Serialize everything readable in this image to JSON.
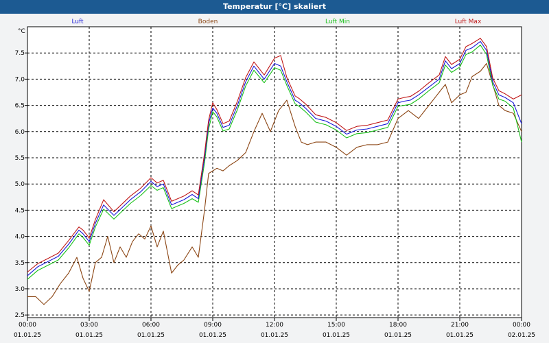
{
  "window": {
    "title": "Temperatur [°C] skaliert"
  },
  "chart_data": {
    "type": "line",
    "title": "Temperatur [°C] skaliert",
    "ylabel": "°C",
    "ylim": [
      2.45,
      8.0
    ],
    "xlim": [
      0,
      24
    ],
    "yticks": [
      "2.5",
      "3.0",
      "3.5",
      "4.0",
      "4.5",
      "5.0",
      "5.5",
      "6.0",
      "6.5",
      "7.0",
      "7.5"
    ],
    "xticks": [
      {
        "time": "00:00",
        "date": "01.01.25"
      },
      {
        "time": "03:00",
        "date": "01.01.25"
      },
      {
        "time": "06:00",
        "date": "01.01.25"
      },
      {
        "time": "09:00",
        "date": "01.01.25"
      },
      {
        "time": "12:00",
        "date": "01.01.25"
      },
      {
        "time": "15:00",
        "date": "01.01.25"
      },
      {
        "time": "18:00",
        "date": "01.01.25"
      },
      {
        "time": "21:00",
        "date": "01.01.25"
      },
      {
        "time": "00:00",
        "date": "02.01.25"
      }
    ],
    "grid": true,
    "legend_position": "top",
    "colors": {
      "Luft": "#1818d8",
      "Boden": "#8b4513",
      "Luft Min": "#18c018",
      "Luft Max": "#c01818"
    },
    "series": [
      {
        "name": "Luft",
        "x": [
          0,
          0.5,
          1,
          1.5,
          2,
          2.5,
          2.7,
          3.0,
          3.3,
          3.7,
          4.2,
          4.6,
          5,
          5.5,
          6,
          6.3,
          6.6,
          7,
          7.3,
          7.6,
          8,
          8.3,
          8.6,
          8.8,
          9.0,
          9.2,
          9.5,
          9.8,
          10.2,
          10.6,
          11,
          11.5,
          12,
          12.3,
          12.6,
          13,
          13.2,
          13.5,
          14,
          14.5,
          15,
          15.5,
          16,
          16.5,
          17,
          17.5,
          18,
          18.3,
          18.6,
          19,
          19.5,
          20,
          20.3,
          20.6,
          21,
          21.3,
          21.6,
          22,
          22.3,
          22.6,
          22.9,
          23.2,
          23.6,
          24
        ],
        "y": [
          3.25,
          3.42,
          3.52,
          3.62,
          3.85,
          4.12,
          4.05,
          3.9,
          4.25,
          4.6,
          4.4,
          4.55,
          4.7,
          4.85,
          5.05,
          4.95,
          5.0,
          4.6,
          4.65,
          4.7,
          4.8,
          4.72,
          5.5,
          6.15,
          6.45,
          6.35,
          6.08,
          6.12,
          6.5,
          6.95,
          7.25,
          7.0,
          7.3,
          7.25,
          6.95,
          6.6,
          6.55,
          6.45,
          6.25,
          6.2,
          6.1,
          5.95,
          6.03,
          6.05,
          6.1,
          6.15,
          6.55,
          6.58,
          6.6,
          6.7,
          6.85,
          7.0,
          7.35,
          7.2,
          7.3,
          7.55,
          7.6,
          7.72,
          7.55,
          6.95,
          6.7,
          6.65,
          6.55,
          6.15
        ]
      },
      {
        "name": "Boden",
        "x": [
          0,
          0.4,
          0.8,
          1.2,
          1.6,
          2,
          2.4,
          2.7,
          3.0,
          3.3,
          3.6,
          3.9,
          4.2,
          4.5,
          4.8,
          5.1,
          5.4,
          5.7,
          6.0,
          6.3,
          6.6,
          7.0,
          7.3,
          7.6,
          8.0,
          8.3,
          8.6,
          8.8,
          9.0,
          9.2,
          9.5,
          9.8,
          10.2,
          10.6,
          11,
          11.4,
          11.8,
          12.2,
          12.6,
          13.0,
          13.3,
          13.6,
          14,
          14.5,
          15,
          15.5,
          16,
          16.5,
          17,
          17.5,
          18,
          18.5,
          19,
          19.5,
          20,
          20.3,
          20.6,
          21,
          21.3,
          21.6,
          22,
          22.3,
          22.6,
          22.9,
          23.2,
          23.6,
          24
        ],
        "y": [
          2.85,
          2.85,
          2.7,
          2.85,
          3.1,
          3.3,
          3.6,
          3.2,
          2.95,
          3.5,
          3.6,
          4.0,
          3.5,
          3.8,
          3.6,
          3.9,
          4.05,
          3.95,
          4.2,
          3.8,
          4.1,
          3.3,
          3.45,
          3.55,
          3.8,
          3.6,
          4.5,
          5.2,
          5.25,
          5.3,
          5.25,
          5.35,
          5.45,
          5.6,
          6.0,
          6.35,
          6.0,
          6.4,
          6.6,
          6.1,
          5.8,
          5.75,
          5.8,
          5.8,
          5.7,
          5.55,
          5.7,
          5.75,
          5.75,
          5.8,
          6.25,
          6.4,
          6.25,
          6.5,
          6.75,
          6.9,
          6.55,
          6.7,
          6.75,
          7.05,
          7.15,
          7.3,
          6.9,
          6.5,
          6.4,
          6.35,
          6.0
        ]
      },
      {
        "name": "Luft Min",
        "x": [
          0,
          0.5,
          1,
          1.5,
          2,
          2.5,
          2.7,
          3.0,
          3.3,
          3.7,
          4.2,
          4.6,
          5,
          5.5,
          6,
          6.3,
          6.6,
          7,
          7.3,
          7.6,
          8,
          8.3,
          8.6,
          8.8,
          9.0,
          9.2,
          9.5,
          9.8,
          10.2,
          10.6,
          11,
          11.5,
          12,
          12.3,
          12.6,
          13,
          13.2,
          13.5,
          14,
          14.5,
          15,
          15.5,
          16,
          16.5,
          17,
          17.5,
          18,
          18.3,
          18.6,
          19,
          19.5,
          20,
          20.3,
          20.6,
          21,
          21.3,
          21.6,
          22,
          22.3,
          22.6,
          22.9,
          23.2,
          23.6,
          24
        ],
        "y": [
          3.18,
          3.35,
          3.45,
          3.55,
          3.78,
          4.05,
          3.98,
          3.83,
          4.18,
          4.52,
          4.33,
          4.48,
          4.63,
          4.78,
          4.97,
          4.88,
          4.93,
          4.53,
          4.58,
          4.63,
          4.72,
          4.65,
          5.4,
          6.05,
          6.38,
          6.28,
          6.01,
          6.05,
          6.42,
          6.87,
          7.17,
          6.93,
          7.22,
          7.17,
          6.88,
          6.53,
          6.48,
          6.38,
          6.18,
          6.13,
          6.03,
          5.88,
          5.96,
          5.98,
          6.03,
          6.08,
          6.48,
          6.5,
          6.52,
          6.62,
          6.78,
          6.93,
          7.27,
          7.13,
          7.23,
          7.47,
          7.52,
          7.65,
          7.47,
          6.88,
          6.62,
          6.58,
          6.45,
          5.8
        ]
      },
      {
        "name": "Luft Max",
        "x": [
          0,
          0.5,
          1,
          1.5,
          2,
          2.5,
          2.7,
          3.0,
          3.3,
          3.7,
          4.2,
          4.6,
          5,
          5.5,
          6,
          6.3,
          6.6,
          7,
          7.3,
          7.6,
          8,
          8.3,
          8.6,
          8.8,
          9.0,
          9.2,
          9.5,
          9.8,
          10.2,
          10.6,
          11,
          11.5,
          12,
          12.3,
          12.6,
          13,
          13.2,
          13.5,
          14,
          14.5,
          15,
          15.5,
          16,
          16.5,
          17,
          17.5,
          18,
          18.3,
          18.6,
          19,
          19.5,
          20,
          20.3,
          20.6,
          21,
          21.3,
          21.6,
          22,
          22.3,
          22.6,
          22.9,
          23.2,
          23.6,
          24
        ],
        "y": [
          3.32,
          3.48,
          3.58,
          3.68,
          3.92,
          4.18,
          4.12,
          3.97,
          4.32,
          4.7,
          4.47,
          4.62,
          4.77,
          4.92,
          5.12,
          5.02,
          5.07,
          4.67,
          4.72,
          4.77,
          4.87,
          4.79,
          5.58,
          6.22,
          6.55,
          6.42,
          6.15,
          6.2,
          6.58,
          7.03,
          7.33,
          7.08,
          7.4,
          7.45,
          7.03,
          6.68,
          6.63,
          6.53,
          6.32,
          6.27,
          6.17,
          6.02,
          6.1,
          6.12,
          6.17,
          6.22,
          6.62,
          6.65,
          6.67,
          6.77,
          6.93,
          7.08,
          7.43,
          7.28,
          7.38,
          7.62,
          7.68,
          7.78,
          7.62,
          7.02,
          6.78,
          6.72,
          6.62,
          6.7
        ]
      }
    ]
  }
}
